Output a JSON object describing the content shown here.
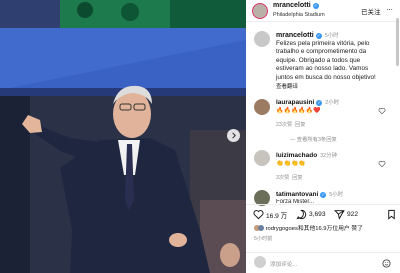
{
  "post": {
    "username": "mrancelotti",
    "location": "Philadelphia Stadium",
    "follow_label": "已关注",
    "more_label": "···",
    "caption_time": "5小时",
    "caption_lines": [
      "Felizes pela primeira vitória, pelo",
      "trabalho e comprometimento da",
      "equipe. Obrigado a todos que",
      "estiveram ao nosso lado. Vamos",
      "juntos em busca do nosso objetivo!"
    ],
    "see_translation": "查看翻译"
  },
  "comments": [
    {
      "username": "laurapausini",
      "time": "2小时",
      "text": "🔥🔥🔥🔥🔥❤️",
      "likes": "23次赞",
      "reply": "回复",
      "view_replies": "查看所有3条回复"
    },
    {
      "username": "luizimachado",
      "time": "32分钟",
      "text": "👏👏👏👏",
      "likes": "3次赞",
      "reply": "回复"
    },
    {
      "username": "tatimantovani",
      "time": "5小时",
      "text": "Forza Mister..."
    }
  ],
  "actions": {
    "likes": "16.9 万",
    "comments": "3,693",
    "shares": "922"
  },
  "liked_by": "rodrygogoes和其他16.9万位用户 赞了",
  "post_age": "5小时前",
  "add_comment_placeholder": "添加评论..."
}
